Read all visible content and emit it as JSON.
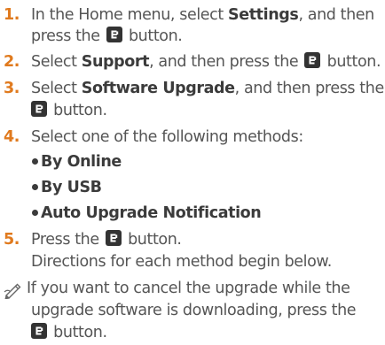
{
  "steps": [
    {
      "number": "1.",
      "line1_a": "In the Home menu, select ",
      "line1_b": "Settings",
      "line1_c": ", and then",
      "line2_a": "press the",
      "line2_b": "button."
    },
    {
      "number": "2.",
      "line1_a": "Select ",
      "line1_b": "Support",
      "line1_c": ", and then press the",
      "line1_d": "button."
    },
    {
      "number": "3.",
      "line1_a": "Select ",
      "line1_b": "Software Upgrade",
      "line1_c": ", and then press the",
      "line2_a": "button."
    },
    {
      "number": "4.",
      "line1_a": "Select one of the following methods:",
      "options": [
        "By Online",
        "By USB",
        "Auto Upgrade Notification"
      ]
    },
    {
      "number": "5.",
      "line1_a": "Press the",
      "line1_b": "button.",
      "line2_a": "Directions for each method begin below."
    }
  ],
  "note": {
    "icon": "pencil-note-icon",
    "line1": "If you want to cancel the upgrade while the",
    "line2": "upgrade software is downloading, press the",
    "line3": "button."
  },
  "colors": {
    "step_number": "#e07a1e",
    "body_text": "#555555",
    "bold_text": "#3b3b3b",
    "button_icon": "#333333"
  }
}
